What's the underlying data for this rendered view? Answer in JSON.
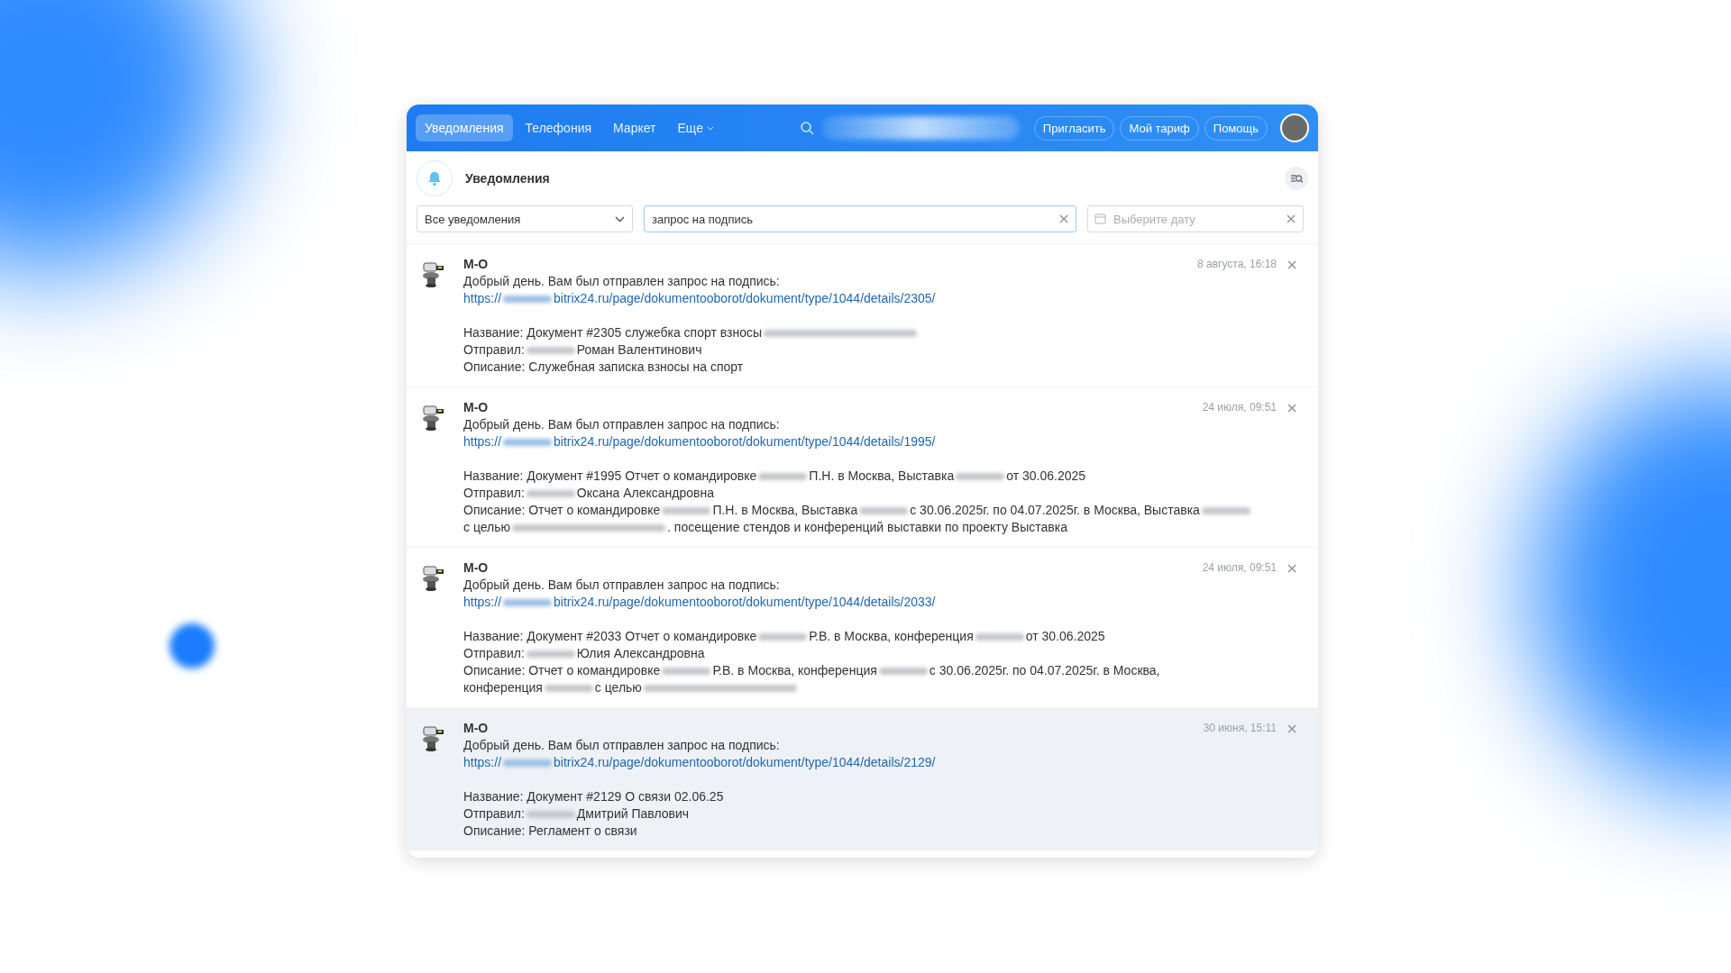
{
  "header": {
    "tabs": [
      {
        "label": "Уведомления",
        "selected": true,
        "kind": "tab"
      },
      {
        "label": "Телефония",
        "selected": false,
        "kind": "tab"
      },
      {
        "label": "Маркет",
        "selected": false,
        "kind": "tab"
      },
      {
        "label": "Еще",
        "selected": false,
        "kind": "menu"
      }
    ],
    "buttons": [
      "Пригласить",
      "Мой тариф",
      "Помощь"
    ]
  },
  "panel": {
    "title": "Уведомления",
    "filter": {
      "value": "Все уведомления"
    },
    "search": {
      "value": "запрос на подпись"
    },
    "date": {
      "placeholder": "Выберите дату"
    }
  },
  "notifications": [
    {
      "author": "М-О",
      "time": "8 августа, 16:18",
      "highlighted": false,
      "lines": [
        {
          "kind": "text",
          "parts": [
            {
              "kind": "text",
              "text": "Добрый день. Вам был отправлен запрос на подпись:"
            }
          ]
        },
        {
          "kind": "link",
          "parts": [
            {
              "kind": "text",
              "text": "https://"
            },
            {
              "kind": "blur"
            },
            {
              "kind": "text",
              "text": "bitrix24.ru/page/dokumentooborot/dokument/type/1044/details/2305/"
            }
          ]
        },
        {
          "kind": "gap"
        },
        {
          "kind": "text",
          "parts": [
            {
              "kind": "text",
              "text": "Название: Документ #2305 служебка спорт взносы"
            },
            {
              "kind": "blur_long"
            }
          ]
        },
        {
          "kind": "text",
          "parts": [
            {
              "kind": "text",
              "text": "Отправил:"
            },
            {
              "kind": "blur"
            },
            {
              "kind": "text",
              "text": "Роман Валентинович"
            }
          ]
        },
        {
          "kind": "text",
          "parts": [
            {
              "kind": "text",
              "text": "Описание: Служебная записка взносы на спорт"
            }
          ]
        }
      ]
    },
    {
      "author": "М-О",
      "time": "24 июля, 09:51",
      "highlighted": false,
      "lines": [
        {
          "kind": "text",
          "parts": [
            {
              "kind": "text",
              "text": "Добрый день. Вам был отправлен запрос на подпись:"
            }
          ]
        },
        {
          "kind": "link",
          "parts": [
            {
              "kind": "text",
              "text": "https://"
            },
            {
              "kind": "blur"
            },
            {
              "kind": "text",
              "text": "bitrix24.ru/page/dokumentooborot/dokument/type/1044/details/1995/"
            }
          ]
        },
        {
          "kind": "gap"
        },
        {
          "kind": "text",
          "parts": [
            {
              "kind": "text",
              "text": "Название: Документ #1995 Отчет о командировке"
            },
            {
              "kind": "blur"
            },
            {
              "kind": "text",
              "text": "П.Н. в Москва, Выставка"
            },
            {
              "kind": "blur"
            },
            {
              "kind": "text",
              "text": "от 30.06.2025"
            }
          ]
        },
        {
          "kind": "text",
          "parts": [
            {
              "kind": "text",
              "text": "Отправил:"
            },
            {
              "kind": "blur"
            },
            {
              "kind": "text",
              "text": "Оксана Александровна"
            }
          ]
        },
        {
          "kind": "text",
          "parts": [
            {
              "kind": "text",
              "text": "Описание: Отчет о командировке"
            },
            {
              "kind": "blur"
            },
            {
              "kind": "text",
              "text": "П.Н. в Москва, Выставка"
            },
            {
              "kind": "blur"
            },
            {
              "kind": "text",
              "text": "с 30.06.2025г. по 04.07.2025г. в Москва, Выставка"
            },
            {
              "kind": "blur"
            }
          ]
        },
        {
          "kind": "text",
          "parts": [
            {
              "kind": "text",
              "text": "с целью"
            },
            {
              "kind": "blur_long"
            },
            {
              "kind": "text",
              "text": ". посещение стендов и конференций выставки по проекту Выставка"
            }
          ]
        }
      ]
    },
    {
      "author": "М-О",
      "time": "24 июля, 09:51",
      "highlighted": false,
      "lines": [
        {
          "kind": "text",
          "parts": [
            {
              "kind": "text",
              "text": "Добрый день. Вам был отправлен запрос на подпись:"
            }
          ]
        },
        {
          "kind": "link",
          "parts": [
            {
              "kind": "text",
              "text": "https://"
            },
            {
              "kind": "blur"
            },
            {
              "kind": "text",
              "text": "bitrix24.ru/page/dokumentooborot/dokument/type/1044/details/2033/"
            }
          ]
        },
        {
          "kind": "gap"
        },
        {
          "kind": "text",
          "parts": [
            {
              "kind": "text",
              "text": "Название: Документ #2033 Отчет о командировке"
            },
            {
              "kind": "blur"
            },
            {
              "kind": "text",
              "text": "Р.В. в Москва, конференция"
            },
            {
              "kind": "blur"
            },
            {
              "kind": "text",
              "text": "от 30.06.2025"
            }
          ]
        },
        {
          "kind": "text",
          "parts": [
            {
              "kind": "text",
              "text": "Отправил:"
            },
            {
              "kind": "blur"
            },
            {
              "kind": "text",
              "text": "Юлия Александровна"
            }
          ]
        },
        {
          "kind": "text",
          "parts": [
            {
              "kind": "text",
              "text": "Описание: Отчет о командировке"
            },
            {
              "kind": "blur"
            },
            {
              "kind": "text",
              "text": "Р.В. в Москва, конференция"
            },
            {
              "kind": "blur"
            },
            {
              "kind": "text",
              "text": "с 30.06.2025г. по 04.07.2025г. в Москва,"
            }
          ]
        },
        {
          "kind": "text",
          "parts": [
            {
              "kind": "text",
              "text": "конференция"
            },
            {
              "kind": "blur"
            },
            {
              "kind": "text",
              "text": "с целью"
            },
            {
              "kind": "blur_long"
            }
          ]
        }
      ]
    },
    {
      "author": "М-О",
      "time": "30 июня, 15:11",
      "highlighted": true,
      "lines": [
        {
          "kind": "text",
          "parts": [
            {
              "kind": "text",
              "text": "Добрый день. Вам был отправлен запрос на подпись:"
            }
          ]
        },
        {
          "kind": "link",
          "parts": [
            {
              "kind": "text",
              "text": "https://"
            },
            {
              "kind": "blur"
            },
            {
              "kind": "text",
              "text": "bitrix24.ru/page/dokumentooborot/dokument/type/1044/details/2129/"
            }
          ]
        },
        {
          "kind": "gap"
        },
        {
          "kind": "text",
          "parts": [
            {
              "kind": "text",
              "text": "Название: Документ #2129 О связи 02.06.25"
            }
          ]
        },
        {
          "kind": "text",
          "parts": [
            {
              "kind": "text",
              "text": "Отправил:"
            },
            {
              "kind": "blur"
            },
            {
              "kind": "text",
              "text": "Дмитрий Павлович"
            }
          ]
        },
        {
          "kind": "text",
          "parts": [
            {
              "kind": "text",
              "text": "Описание: Регламент о связи"
            }
          ]
        }
      ]
    }
  ]
}
